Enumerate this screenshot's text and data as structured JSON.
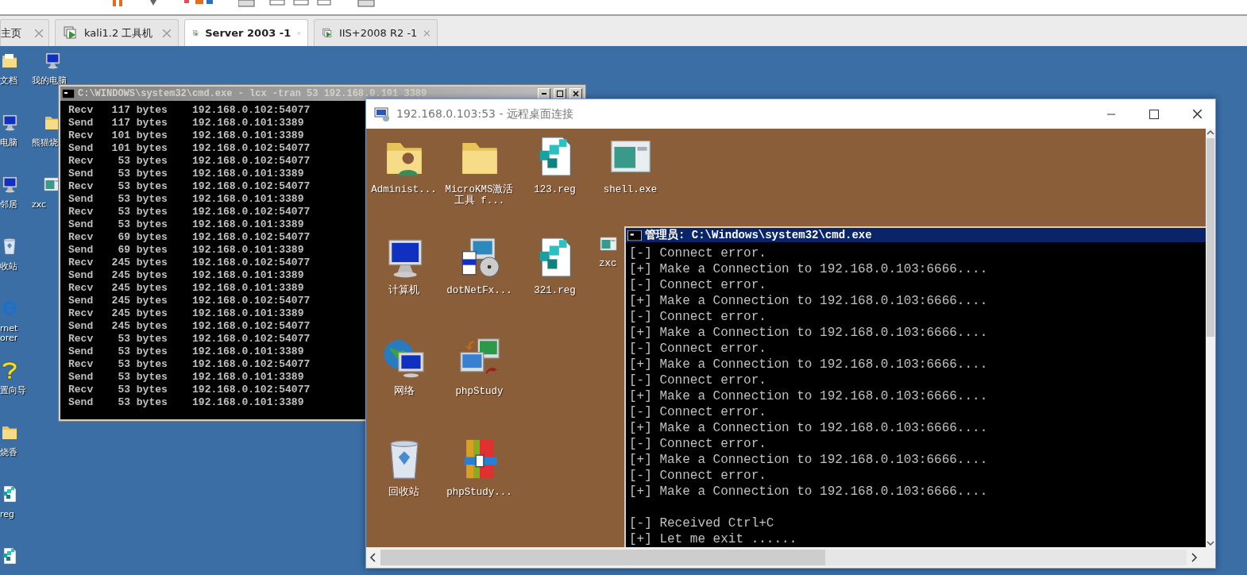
{
  "tabs": [
    {
      "label": "主页",
      "selected": false
    },
    {
      "label": "kali1.2 工具机",
      "selected": false
    },
    {
      "label": "Server 2003 -1",
      "selected": true
    },
    {
      "label": "IIS+2008 R2 -1",
      "selected": false
    }
  ],
  "host_desktop": {
    "icons_column_1": [
      {
        "label": "文档",
        "kind": "documents"
      },
      {
        "label": "电脑",
        "kind": "computer"
      },
      {
        "label": "邻居",
        "kind": "computer"
      },
      {
        "label": "收站",
        "kind": "recycle"
      },
      {
        "label": "rnet\norer",
        "kind": "browser"
      },
      {
        "label": "置向导",
        "kind": "help"
      },
      {
        "label": "烧香",
        "kind": "folder"
      },
      {
        "label": "reg",
        "kind": "reg"
      },
      {
        "kind": "reg"
      }
    ],
    "icons_column_2": [
      {
        "label": "我的电脑",
        "kind": "computer"
      },
      {
        "label": "熊猫烧",
        "kind": "folder"
      },
      {
        "label": "zxc",
        "kind": "window"
      }
    ]
  },
  "lcx_window": {
    "title": "C:\\WINDOWS\\system32\\cmd.exe - lcx -tran 53 192.168.0.101 3389",
    "lines": [
      "Recv   117 bytes    192.168.0.102:54077",
      "Send   117 bytes    192.168.0.101:3389",
      "Recv   101 bytes    192.168.0.101:3389",
      "Send   101 bytes    192.168.0.102:54077",
      "Recv    53 bytes    192.168.0.102:54077",
      "Send    53 bytes    192.168.0.101:3389",
      "Recv    53 bytes    192.168.0.102:54077",
      "Send    53 bytes    192.168.0.101:3389",
      "Recv    53 bytes    192.168.0.102:54077",
      "Send    53 bytes    192.168.0.101:3389",
      "Recv    69 bytes    192.168.0.102:54077",
      "Send    69 bytes    192.168.0.101:3389",
      "Recv   245 bytes    192.168.0.102:54077",
      "Send   245 bytes    192.168.0.101:3389",
      "Recv   245 bytes    192.168.0.101:3389",
      "Send   245 bytes    192.168.0.102:54077",
      "Recv   245 bytes    192.168.0.101:3389",
      "Send   245 bytes    192.168.0.102:54077",
      "Recv    53 bytes    192.168.0.102:54077",
      "Send    53 bytes    192.168.0.101:3389",
      "Recv    53 bytes    192.168.0.102:54077",
      "Send    53 bytes    192.168.0.101:3389",
      "Recv    53 bytes    192.168.0.102:54077",
      "Send    53 bytes    192.168.0.101:3389"
    ]
  },
  "rdp_window": {
    "title": "192.168.0.103:53 - 远程桌面连接",
    "desktop_icon_rows": [
      [
        {
          "label": "Administ...",
          "kind": "user-folder"
        },
        {
          "label": "MicroKMS激活工具 f...",
          "kind": "folder"
        },
        {
          "label": "123.reg",
          "kind": "reg"
        },
        {
          "label": "shell.exe",
          "kind": "window"
        }
      ],
      [
        {
          "label": "计算机",
          "kind": "computer"
        },
        {
          "label": "dotNetFx...",
          "kind": "installer"
        },
        {
          "label": "321.reg",
          "kind": "reg"
        },
        {
          "label": "zxc",
          "kind": "window"
        }
      ],
      [
        {
          "label": "网络",
          "kind": "globe"
        },
        {
          "label": "phpStudy",
          "kind": "network-app"
        }
      ],
      [
        {
          "label": "回收站",
          "kind": "recycle"
        },
        {
          "label": "phpStudy...",
          "kind": "zip"
        }
      ]
    ],
    "cmd_window": {
      "title": "管理员: C:\\Windows\\system32\\cmd.exe",
      "lines": [
        "[-] Connect error.",
        "[+] Make a Connection to 192.168.0.103:6666....",
        "[-] Connect error.",
        "[+] Make a Connection to 192.168.0.103:6666....",
        "[-] Connect error.",
        "[+] Make a Connection to 192.168.0.103:6666....",
        "[-] Connect error.",
        "[+] Make a Connection to 192.168.0.103:6666....",
        "[-] Connect error.",
        "[+] Make a Connection to 192.168.0.103:6666....",
        "[-] Connect error.",
        "[+] Make a Connection to 192.168.0.103:6666....",
        "[-] Connect error.",
        "[+] Make a Connection to 192.168.0.103:6666....",
        "[-] Connect error.",
        "[+] Make a Connection to 192.168.0.103:6666...."
      ],
      "exit_lines": [
        "[-] Received Ctrl+C",
        "[+] Let me exit ......"
      ]
    }
  }
}
